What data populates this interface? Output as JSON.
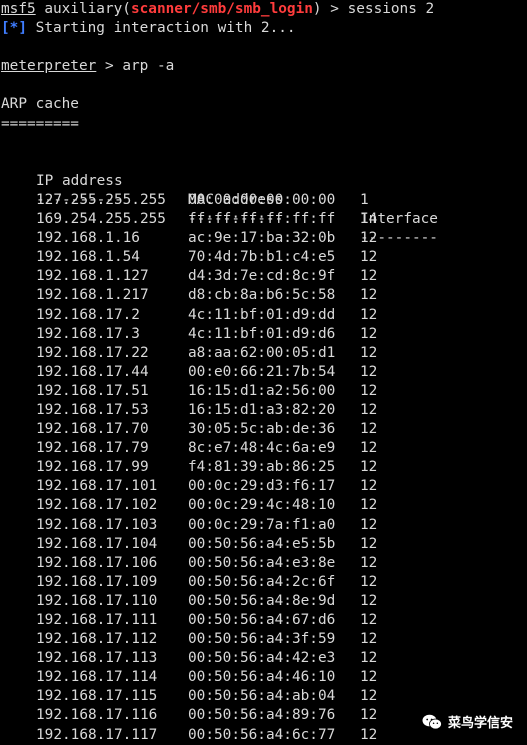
{
  "prompt1": {
    "prefix": "msf5",
    "module_prefix": " auxiliary(",
    "module": "scanner/smb/smb_login",
    "module_suffix": ") > ",
    "command": "sessions 2"
  },
  "status": {
    "marker": "[*]",
    "text": " Starting interaction with 2..."
  },
  "prompt2": {
    "prefix": "meterpreter",
    "arrow": " > ",
    "command": "arp -a"
  },
  "arp": {
    "title": "ARP cache",
    "title_rule": "=========",
    "headers": {
      "ip": "IP address",
      "mac": "MAC address",
      "iface": "Interface"
    },
    "rules": {
      "ip": "----------",
      "mac": "-----------",
      "iface": "---------"
    },
    "rows": [
      {
        "ip": "127.255.255.255",
        "mac": "00:00:00:00:00:00",
        "iface": "1"
      },
      {
        "ip": "169.254.255.255",
        "mac": "ff:ff:ff:ff:ff:ff",
        "iface": "14"
      },
      {
        "ip": "192.168.1.16",
        "mac": "ac:9e:17:ba:32:0b",
        "iface": "12"
      },
      {
        "ip": "192.168.1.54",
        "mac": "70:4d:7b:b1:c4:e5",
        "iface": "12"
      },
      {
        "ip": "192.168.1.127",
        "mac": "d4:3d:7e:cd:8c:9f",
        "iface": "12"
      },
      {
        "ip": "192.168.1.217",
        "mac": "d8:cb:8a:b6:5c:58",
        "iface": "12"
      },
      {
        "ip": "192.168.17.2",
        "mac": "4c:11:bf:01:d9:dd",
        "iface": "12"
      },
      {
        "ip": "192.168.17.3",
        "mac": "4c:11:bf:01:d9:d6",
        "iface": "12"
      },
      {
        "ip": "192.168.17.22",
        "mac": "a8:aa:62:00:05:d1",
        "iface": "12"
      },
      {
        "ip": "192.168.17.44",
        "mac": "00:e0:66:21:7b:54",
        "iface": "12"
      },
      {
        "ip": "192.168.17.51",
        "mac": "16:15:d1:a2:56:00",
        "iface": "12"
      },
      {
        "ip": "192.168.17.53",
        "mac": "16:15:d1:a3:82:20",
        "iface": "12"
      },
      {
        "ip": "192.168.17.70",
        "mac": "30:05:5c:ab:de:36",
        "iface": "12"
      },
      {
        "ip": "192.168.17.79",
        "mac": "8c:e7:48:4c:6a:e9",
        "iface": "12"
      },
      {
        "ip": "192.168.17.99",
        "mac": "f4:81:39:ab:86:25",
        "iface": "12"
      },
      {
        "ip": "192.168.17.101",
        "mac": "00:0c:29:d3:f6:17",
        "iface": "12"
      },
      {
        "ip": "192.168.17.102",
        "mac": "00:0c:29:4c:48:10",
        "iface": "12"
      },
      {
        "ip": "192.168.17.103",
        "mac": "00:0c:29:7a:f1:a0",
        "iface": "12"
      },
      {
        "ip": "192.168.17.104",
        "mac": "00:50:56:a4:e5:5b",
        "iface": "12"
      },
      {
        "ip": "192.168.17.106",
        "mac": "00:50:56:a4:e3:8e",
        "iface": "12"
      },
      {
        "ip": "192.168.17.109",
        "mac": "00:50:56:a4:2c:6f",
        "iface": "12"
      },
      {
        "ip": "192.168.17.110",
        "mac": "00:50:56:a4:8e:9d",
        "iface": "12"
      },
      {
        "ip": "192.168.17.111",
        "mac": "00:50:56:a4:67:d6",
        "iface": "12"
      },
      {
        "ip": "192.168.17.112",
        "mac": "00:50:56:a4:3f:59",
        "iface": "12"
      },
      {
        "ip": "192.168.17.113",
        "mac": "00:50:56:a4:42:e3",
        "iface": "12"
      },
      {
        "ip": "192.168.17.114",
        "mac": "00:50:56:a4:46:10",
        "iface": "12"
      },
      {
        "ip": "192.168.17.115",
        "mac": "00:50:56:a4:ab:04",
        "iface": "12"
      },
      {
        "ip": "192.168.17.116",
        "mac": "00:50:56:a4:89:76",
        "iface": "12"
      },
      {
        "ip": "192.168.17.117",
        "mac": "00:50:56:a4:6c:77",
        "iface": "12"
      }
    ]
  },
  "watermark": {
    "icon": "wechat-icon",
    "text": "菜鸟学信安"
  },
  "colors": {
    "background": "#000000",
    "text": "#d9d9d9",
    "module": "#ff3c3c",
    "status_marker": "#3f7dff"
  }
}
